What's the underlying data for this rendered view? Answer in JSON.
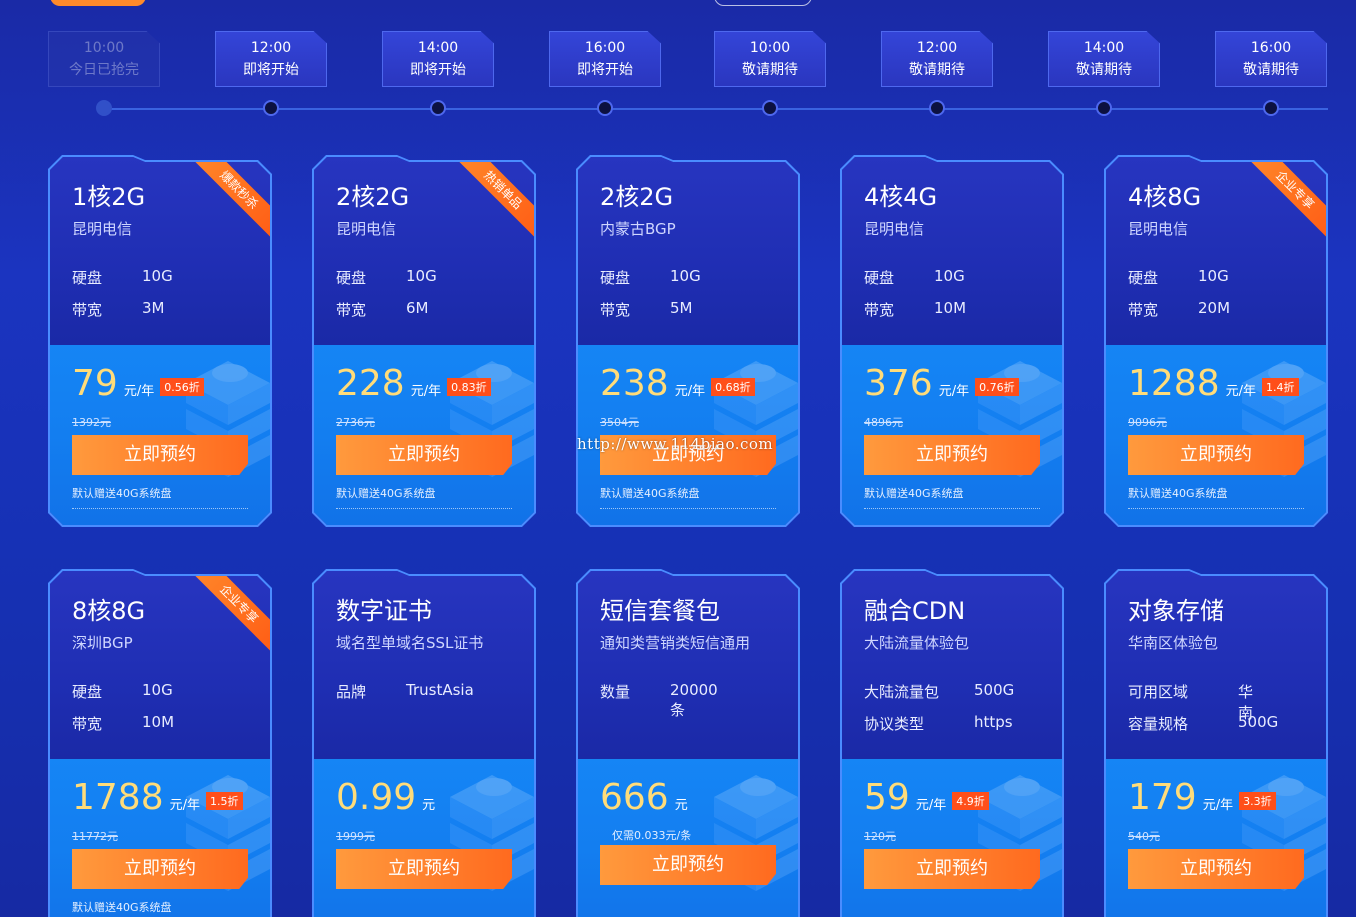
{
  "timeline": [
    {
      "time": "10:00",
      "status": "今日已抢完",
      "done": true
    },
    {
      "time": "12:00",
      "status": "即将开始",
      "done": false
    },
    {
      "time": "14:00",
      "status": "即将开始",
      "done": false
    },
    {
      "time": "16:00",
      "status": "即将开始",
      "done": false
    },
    {
      "time": "10:00",
      "status": "敬请期待",
      "done": false
    },
    {
      "time": "12:00",
      "status": "敬请期待",
      "done": false
    },
    {
      "time": "14:00",
      "status": "敬请期待",
      "done": false
    },
    {
      "time": "16:00",
      "status": "敬请期待",
      "done": false
    }
  ],
  "cards_row1": [
    {
      "title": "1核2G",
      "sub": "昆明电信",
      "ribbon": "爆款秒杀",
      "specs": [
        [
          "硬盘",
          "10G"
        ],
        [
          "带宽",
          "3M"
        ]
      ],
      "price": "79",
      "unit": "元/年",
      "disc": "0.56折",
      "orig": "1392元",
      "btn": "立即预约",
      "gift": "默认赠送40G系统盘"
    },
    {
      "title": "2核2G",
      "sub": "昆明电信",
      "ribbon": "热销单品",
      "specs": [
        [
          "硬盘",
          "10G"
        ],
        [
          "带宽",
          "6M"
        ]
      ],
      "price": "228",
      "unit": "元/年",
      "disc": "0.83折",
      "orig": "2736元",
      "btn": "立即预约",
      "gift": "默认赠送40G系统盘"
    },
    {
      "title": "2核2G",
      "sub": "内蒙古BGP",
      "ribbon": "",
      "specs": [
        [
          "硬盘",
          "10G"
        ],
        [
          "带宽",
          "5M"
        ]
      ],
      "price": "238",
      "unit": "元/年",
      "disc": "0.68折",
      "orig": "3504元",
      "btn": "立即预约",
      "gift": "默认赠送40G系统盘"
    },
    {
      "title": "4核4G",
      "sub": "昆明电信",
      "ribbon": "",
      "specs": [
        [
          "硬盘",
          "10G"
        ],
        [
          "带宽",
          "10M"
        ]
      ],
      "price": "376",
      "unit": "元/年",
      "disc": "0.76折",
      "orig": "4896元",
      "btn": "立即预约",
      "gift": "默认赠送40G系统盘"
    },
    {
      "title": "4核8G",
      "sub": "昆明电信",
      "ribbon": "企业专享",
      "specs": [
        [
          "硬盘",
          "10G"
        ],
        [
          "带宽",
          "20M"
        ]
      ],
      "price": "1288",
      "unit": "元/年",
      "disc": "1.4折",
      "orig": "9096元",
      "btn": "立即预约",
      "gift": "默认赠送40G系统盘"
    }
  ],
  "cards_row2": [
    {
      "title": "8核8G",
      "sub": "深圳BGP",
      "ribbon": "企业专享",
      "specs": [
        [
          "硬盘",
          "10G"
        ],
        [
          "带宽",
          "10M"
        ]
      ],
      "price": "1788",
      "unit": "元/年",
      "disc": "1.5折",
      "orig": "11772元",
      "btn": "立即预约",
      "gift": "默认赠送40G系统盘"
    },
    {
      "title": "数字证书",
      "sub": "域名型单域名SSL证书",
      "ribbon": "",
      "specs": [
        [
          "品牌",
          "TrustAsia"
        ]
      ],
      "price": "0.99",
      "unit": "元",
      "disc": "",
      "orig": "1999元",
      "btn": "立即预约",
      "gift": ""
    },
    {
      "title": "短信套餐包",
      "sub": "通知类营销类短信通用",
      "ribbon": "",
      "specs": [
        [
          "数量",
          "20000条"
        ]
      ],
      "price": "666",
      "unit": "元",
      "disc": "",
      "orig": "",
      "note": "仅需0.033元/条",
      "btn": "立即预约",
      "gift": ""
    },
    {
      "title": "融合CDN",
      "sub": "大陆流量体验包",
      "ribbon": "",
      "specs": [
        [
          "大陆流量包",
          "500G"
        ],
        [
          "协议类型",
          "https"
        ]
      ],
      "price": "59",
      "unit": "元/年",
      "disc": "4.9折",
      "orig": "120元",
      "btn": "立即预约",
      "gift": ""
    },
    {
      "title": "对象存储",
      "sub": "华南区体验包",
      "ribbon": "",
      "specs": [
        [
          "可用区域",
          "华南"
        ],
        [
          "容量规格",
          "500G"
        ]
      ],
      "price": "179",
      "unit": "元/年",
      "disc": "3.3折",
      "orig": "540元",
      "btn": "立即预约",
      "gift": ""
    }
  ],
  "watermark": "http://www.114biao.com"
}
